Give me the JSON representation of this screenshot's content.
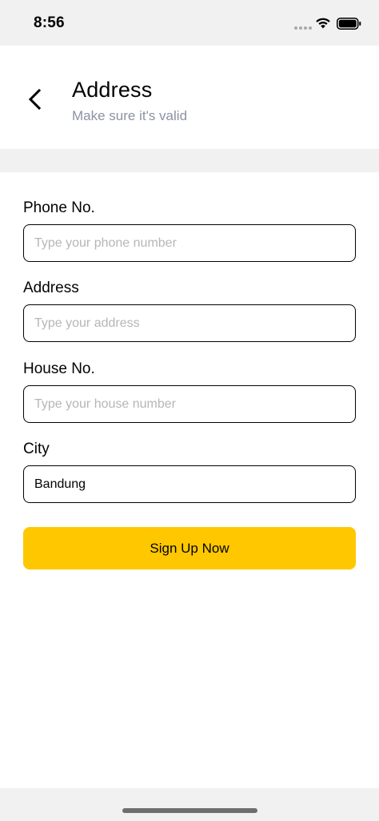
{
  "status_bar": {
    "time": "8:56",
    "icons": [
      "signal-dots-icon",
      "wifi-icon",
      "battery-icon"
    ]
  },
  "header": {
    "back_icon": "chevron-left-icon",
    "title": "Address",
    "subtitle": "Make sure it's valid"
  },
  "form": {
    "fields": [
      {
        "label": "Phone No.",
        "value": "",
        "placeholder": "Type your phone number"
      },
      {
        "label": "Address",
        "value": "",
        "placeholder": "Type your address"
      },
      {
        "label": "House No.",
        "value": "",
        "placeholder": "Type your house number"
      },
      {
        "label": "City",
        "value": "Bandung",
        "placeholder": ""
      }
    ],
    "submit_label": "Sign Up Now"
  },
  "colors": {
    "accent": "#ffc700",
    "subtitle": "#8d92a3",
    "background_gray": "#f1f1f1",
    "text": "#020202",
    "placeholder": "#b6b6b6"
  }
}
